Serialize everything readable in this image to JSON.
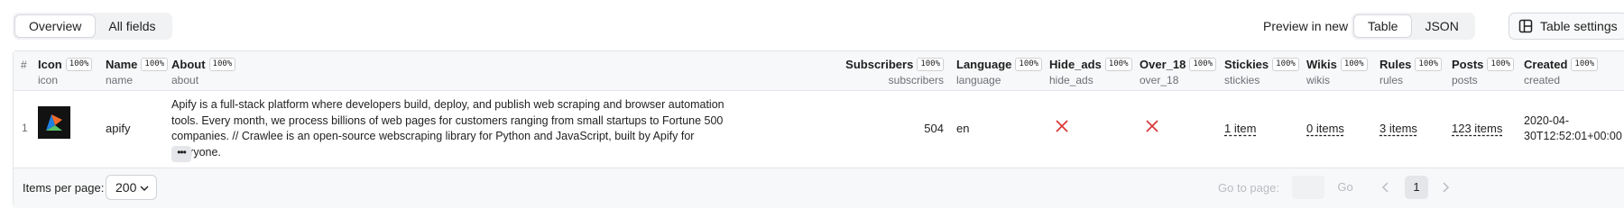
{
  "toolbar": {
    "view_tabs": [
      {
        "label": "Overview",
        "active": true
      },
      {
        "label": "All fields",
        "active": false
      }
    ],
    "preview_link": "Preview in new tab",
    "format_tabs": [
      {
        "label": "Table",
        "active": true
      },
      {
        "label": "JSON",
        "active": false
      }
    ],
    "table_settings": "Table settings"
  },
  "table": {
    "hash": "#",
    "columns": [
      {
        "label": "Icon",
        "key": "icon",
        "coverage": "100%"
      },
      {
        "label": "Name",
        "key": "name",
        "coverage": "100%"
      },
      {
        "label": "About",
        "key": "about",
        "coverage": "100%"
      },
      {
        "label": "Subscribers",
        "key": "subscribers",
        "coverage": "100%"
      },
      {
        "label": "Language",
        "key": "language",
        "coverage": "100%"
      },
      {
        "label": "Hide_ads",
        "key": "hide_ads",
        "coverage": "100%"
      },
      {
        "label": "Over_18",
        "key": "over_18",
        "coverage": "100%"
      },
      {
        "label": "Stickies",
        "key": "stickies",
        "coverage": "100%"
      },
      {
        "label": "Wikis",
        "key": "wikis",
        "coverage": "100%"
      },
      {
        "label": "Rules",
        "key": "rules",
        "coverage": "100%"
      },
      {
        "label": "Posts",
        "key": "posts",
        "coverage": "100%"
      },
      {
        "label": "Created",
        "key": "created",
        "coverage": "100%"
      }
    ],
    "rows": [
      {
        "index": "1",
        "icon": "apify-logo",
        "name": "apify",
        "about": "Apify is a full-stack platform where developers build, deploy, and publish web scraping and browser automation tools. Every month, we process billions of web pages for customers ranging from small startups to Fortune 500 companies. // Crawlee is an open-source webscraping library for Python and JavaScript, built by Apify for everyone.",
        "more": "•••",
        "subscribers": "504",
        "language": "en",
        "hide_ads": false,
        "over_18": false,
        "stickies": "1 item",
        "wikis": "0 items",
        "rules": "3 items",
        "posts": "123 items",
        "created": "2020-04-30T12:52:01+00:00"
      }
    ]
  },
  "footer": {
    "items_per_page_label": "Items per page:",
    "items_per_page_value": "200",
    "go_to_page_label": "Go to page:",
    "go_button": "Go",
    "current_page": "1"
  },
  "colors": {
    "false_mark": "#d93a3a",
    "logo_blue": "#1f7fe0",
    "logo_orange": "#f26a2a",
    "logo_green": "#57c46a"
  }
}
